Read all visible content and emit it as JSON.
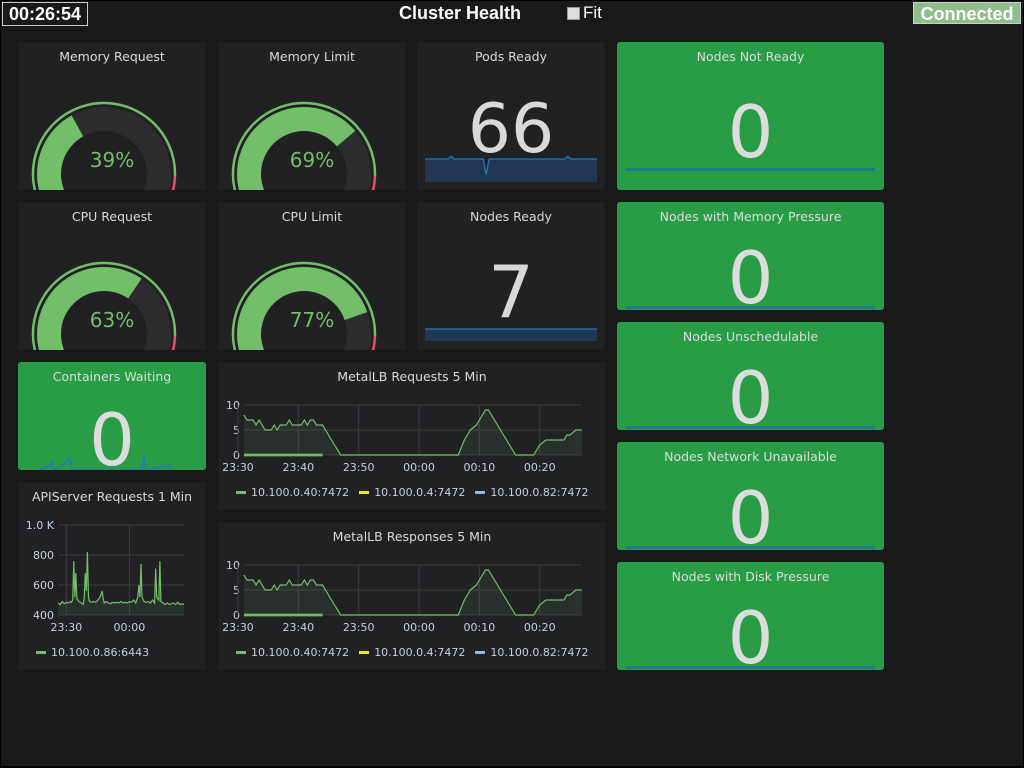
{
  "header": {
    "clock": "00:26:54",
    "title": "Cluster Health",
    "fit_label": "Fit",
    "fit_checked": false,
    "status": "Connected"
  },
  "colors": {
    "ok_green": "#299c46",
    "gauge_green": "#73bf69",
    "gauge_red": "#f2495c",
    "sparkline_blue": "#1f78c1",
    "series_green": "#73bf69",
    "series_yellow": "#fade2a",
    "series_cyan": "#5794f2"
  },
  "gauges": [
    {
      "title": "Memory Request",
      "value": 39,
      "display": "39%"
    },
    {
      "title": "Memory Limit",
      "value": 69,
      "display": "69%"
    },
    {
      "title": "CPU Request",
      "value": 63,
      "display": "63%"
    },
    {
      "title": "CPU Limit",
      "value": 77,
      "display": "77%"
    }
  ],
  "stats": {
    "pods_ready": {
      "title": "Pods Ready",
      "value": "66"
    },
    "nodes_ready": {
      "title": "Nodes Ready",
      "value": "7"
    },
    "containers_waiting": {
      "title": "Containers Waiting",
      "value": "0"
    }
  },
  "node_status": [
    {
      "title": "Nodes Not Ready",
      "value": "0"
    },
    {
      "title": "Nodes with Memory Pressure",
      "value": "0"
    },
    {
      "title": "Nodes Unschedulable",
      "value": "0"
    },
    {
      "title": "Nodes Network Unavailable",
      "value": "0"
    },
    {
      "title": "Nodes with Disk Pressure",
      "value": "0"
    }
  ],
  "chart_data": [
    {
      "type": "area",
      "title": "MetalLB Requests 5 Min",
      "x_ticks": [
        "23:30",
        "23:40",
        "23:50",
        "00:00",
        "00:10",
        "00:20"
      ],
      "y_ticks": [
        "0",
        "5",
        "10"
      ],
      "ylim": [
        0,
        10
      ],
      "x_range_minutes": [
        -29,
        27
      ],
      "series": [
        {
          "name": "10.100.0.40:7472",
          "color": "#73bf69",
          "points": [
            [
              -29,
              8
            ],
            [
              -28.5,
              7
            ],
            [
              -27.5,
              7
            ],
            [
              -27,
              6
            ],
            [
              -26.5,
              7
            ],
            [
              -26,
              6
            ],
            [
              -25.5,
              5
            ],
            [
              -24.5,
              5
            ],
            [
              -24,
              6
            ],
            [
              -23.5,
              5
            ],
            [
              -23,
              6
            ],
            [
              -22,
              6
            ],
            [
              -21.5,
              7
            ],
            [
              -21,
              6
            ],
            [
              -19.5,
              6
            ],
            [
              -19,
              7
            ],
            [
              -18.5,
              6
            ],
            [
              -18,
              7
            ],
            [
              -17.5,
              7
            ],
            [
              -17,
              6
            ],
            [
              -16,
              6
            ],
            [
              -15,
              4
            ],
            [
              -14,
              2
            ],
            [
              -13.5,
              1
            ],
            [
              -13,
              0
            ],
            [
              0,
              0
            ],
            [
              6.5,
              0
            ],
            [
              7.5,
              3
            ],
            [
              8.5,
              5
            ],
            [
              9.5,
              6
            ],
            [
              10,
              7
            ],
            [
              11,
              9
            ],
            [
              11.5,
              9
            ],
            [
              12.5,
              7
            ],
            [
              14,
              4
            ],
            [
              15,
              2
            ],
            [
              16,
              0
            ],
            [
              19,
              0
            ],
            [
              19.5,
              1
            ],
            [
              20,
              2
            ],
            [
              21,
              3
            ],
            [
              24,
              3
            ],
            [
              24.5,
              4
            ],
            [
              25,
              4
            ],
            [
              26,
              5
            ],
            [
              27,
              5
            ]
          ]
        },
        {
          "name": "10.100.0.4:7472",
          "color": "#fade2a",
          "points": [
            [
              -29,
              0
            ],
            [
              -16,
              0
            ]
          ]
        },
        {
          "name": "10.100.0.82:7472",
          "color": "#8ab8ff",
          "points": [
            [
              -29,
              0
            ],
            [
              -16,
              0
            ]
          ]
        }
      ],
      "legend": "bottom"
    },
    {
      "type": "area",
      "title": "MetalLB Responses 5 Min",
      "x_ticks": [
        "23:30",
        "23:40",
        "23:50",
        "00:00",
        "00:10",
        "00:20"
      ],
      "y_ticks": [
        "0",
        "5",
        "10"
      ],
      "ylim": [
        0,
        10
      ],
      "x_range_minutes": [
        -29,
        27
      ],
      "series": [
        {
          "name": "10.100.0.40:7472",
          "color": "#73bf69",
          "points": [
            [
              -29,
              8
            ],
            [
              -28.5,
              7
            ],
            [
              -27.5,
              7
            ],
            [
              -27,
              6
            ],
            [
              -26.5,
              7
            ],
            [
              -26,
              6
            ],
            [
              -25.5,
              5
            ],
            [
              -24.5,
              5
            ],
            [
              -24,
              6
            ],
            [
              -23.5,
              5
            ],
            [
              -23,
              6
            ],
            [
              -22,
              6
            ],
            [
              -21.5,
              7
            ],
            [
              -21,
              6
            ],
            [
              -19.5,
              6
            ],
            [
              -19,
              7
            ],
            [
              -18.5,
              6
            ],
            [
              -18,
              7
            ],
            [
              -17.5,
              7
            ],
            [
              -17,
              6
            ],
            [
              -16,
              6
            ],
            [
              -15,
              4
            ],
            [
              -14,
              2
            ],
            [
              -13.5,
              1
            ],
            [
              -13,
              0
            ],
            [
              0,
              0
            ],
            [
              6.5,
              0
            ],
            [
              7.5,
              3
            ],
            [
              8.5,
              5
            ],
            [
              9.5,
              6
            ],
            [
              10,
              7
            ],
            [
              11,
              9
            ],
            [
              11.5,
              9
            ],
            [
              12.5,
              7
            ],
            [
              14,
              4
            ],
            [
              15,
              2
            ],
            [
              16,
              0
            ],
            [
              19,
              0
            ],
            [
              19.5,
              1
            ],
            [
              20,
              2
            ],
            [
              21,
              3
            ],
            [
              24,
              3
            ],
            [
              24.5,
              4
            ],
            [
              25,
              4
            ],
            [
              26,
              5
            ],
            [
              27,
              5
            ]
          ]
        },
        {
          "name": "10.100.0.4:7472",
          "color": "#fade2a",
          "points": [
            [
              -29,
              0
            ],
            [
              -16,
              0
            ]
          ]
        },
        {
          "name": "10.100.0.82:7472",
          "color": "#8ab8ff",
          "points": [
            [
              -29,
              0
            ],
            [
              -16,
              0
            ]
          ]
        }
      ],
      "legend": "bottom"
    },
    {
      "type": "area",
      "title": "APIServer Requests 1 Min",
      "x_ticks": [
        "23:30",
        "00:00"
      ],
      "y_ticks": [
        "400",
        "600",
        "800",
        "1.0 K"
      ],
      "ylim": [
        400,
        1000
      ],
      "x_range_minutes": [
        -34,
        26
      ],
      "series": [
        {
          "name": "10.100.0.86:6443",
          "color": "#73bf69",
          "points": [
            [
              -34,
              480
            ],
            [
              -33,
              470
            ],
            [
              -32,
              490
            ],
            [
              -31,
              475
            ],
            [
              -30,
              485
            ],
            [
              -29,
              480
            ],
            [
              -28,
              490
            ],
            [
              -27.5,
              485
            ],
            [
              -27,
              500
            ],
            [
              -26.5,
              760
            ],
            [
              -26,
              520
            ],
            [
              -25.5,
              680
            ],
            [
              -25,
              510
            ],
            [
              -24,
              490
            ],
            [
              -23,
              480
            ],
            [
              -22,
              470
            ],
            [
              -21.5,
              520
            ],
            [
              -21,
              680
            ],
            [
              -20.5,
              560
            ],
            [
              -20,
              820
            ],
            [
              -19.5,
              520
            ],
            [
              -19,
              490
            ],
            [
              -18,
              485
            ],
            [
              -17,
              490
            ],
            [
              -16,
              485
            ],
            [
              -15,
              500
            ],
            [
              -14,
              520
            ],
            [
              -13.5,
              540
            ],
            [
              -13,
              560
            ],
            [
              -12.5,
              510
            ],
            [
              -12,
              480
            ],
            [
              -11,
              490
            ],
            [
              -10,
              480
            ],
            [
              -9,
              475
            ],
            [
              -8,
              485
            ],
            [
              -7,
              480
            ],
            [
              -6,
              485
            ],
            [
              -5,
              480
            ],
            [
              -4,
              490
            ],
            [
              -3,
              480
            ],
            [
              -2,
              485
            ],
            [
              -1,
              480
            ],
            [
              0,
              490
            ],
            [
              1,
              485
            ],
            [
              2,
              500
            ],
            [
              3,
              480
            ],
            [
              4,
              520
            ],
            [
              4.5,
              600
            ],
            [
              5,
              520
            ],
            [
              5.5,
              740
            ],
            [
              6,
              520
            ],
            [
              7,
              490
            ],
            [
              8,
              485
            ],
            [
              9,
              490
            ],
            [
              10,
              480
            ],
            [
              11,
              500
            ],
            [
              12,
              480
            ],
            [
              12.5,
              710
            ],
            [
              13,
              520
            ],
            [
              14,
              500
            ],
            [
              14.5,
              760
            ],
            [
              15,
              490
            ],
            [
              16,
              480
            ],
            [
              17,
              470
            ],
            [
              18,
              480
            ],
            [
              19,
              470
            ],
            [
              20,
              475
            ],
            [
              21,
              480
            ],
            [
              22,
              470
            ],
            [
              23,
              485
            ],
            [
              24,
              470
            ],
            [
              25,
              475
            ],
            [
              26,
              470
            ]
          ]
        }
      ],
      "legend": "bottom"
    }
  ],
  "sparklines": {
    "pods_ready": [
      66,
      66,
      66,
      66,
      66,
      66,
      66,
      66,
      66,
      67,
      66,
      66,
      66,
      66,
      66,
      66,
      66,
      66,
      66,
      66,
      66,
      60,
      66,
      66,
      66,
      66,
      66,
      66,
      66,
      66,
      66,
      66,
      66,
      66,
      66,
      66,
      66,
      66,
      66,
      66,
      66,
      66,
      66,
      66,
      66,
      66,
      66,
      66,
      66,
      67,
      66,
      66,
      66,
      66,
      66,
      66,
      66,
      66,
      66,
      66
    ],
    "nodes_ready": [
      7,
      7,
      7,
      7,
      7,
      7,
      7,
      7,
      7,
      7
    ]
  }
}
